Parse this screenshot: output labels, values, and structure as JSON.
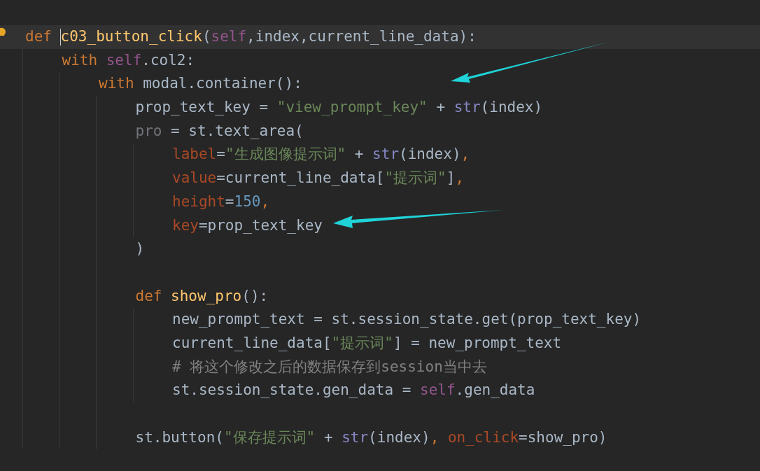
{
  "editor": {
    "lines": [
      {
        "current": true,
        "blank_line_before": false,
        "tokens": [
          {
            "kind": "keyword",
            "text": "def "
          },
          {
            "kind": "function",
            "text": "c03_button_click"
          },
          {
            "kind": "plain",
            "text": "("
          },
          {
            "kind": "self",
            "text": "self"
          },
          {
            "kind": "plain",
            "text": ",index,current_line_data):"
          }
        ],
        "children": [
          {
            "current": false,
            "blank_line_before": false,
            "tokens": [
              {
                "kind": "keyword",
                "text": "with "
              },
              {
                "kind": "self",
                "text": "self"
              },
              {
                "kind": "plain",
                "text": ".col2:"
              }
            ],
            "children": [
              {
                "current": false,
                "blank_line_before": false,
                "tokens": [
                  {
                    "kind": "keyword",
                    "text": "with "
                  },
                  {
                    "kind": "plain",
                    "text": "modal.container():"
                  }
                ],
                "children": [
                  {
                    "current": false,
                    "blank_line_before": false,
                    "tokens": [
                      {
                        "kind": "plain",
                        "text": "prop_text_key = "
                      },
                      {
                        "kind": "string",
                        "text": "\"view_prompt_key\""
                      },
                      {
                        "kind": "plain",
                        "text": " + "
                      },
                      {
                        "kind": "builtin",
                        "text": "str"
                      },
                      {
                        "kind": "plain",
                        "text": "(index)"
                      }
                    ]
                  },
                  {
                    "current": false,
                    "blank_line_before": false,
                    "tokens": [
                      {
                        "kind": "unused",
                        "text": "pro"
                      },
                      {
                        "kind": "plain",
                        "text": " = st.text_area("
                      }
                    ],
                    "children": [
                      {
                        "current": false,
                        "blank_line_before": false,
                        "tokens": [
                          {
                            "kind": "param",
                            "text": "label"
                          },
                          {
                            "kind": "plain",
                            "text": "="
                          },
                          {
                            "kind": "string",
                            "text": "\"生成图像提示词\""
                          },
                          {
                            "kind": "plain",
                            "text": " + "
                          },
                          {
                            "kind": "builtin",
                            "text": "str"
                          },
                          {
                            "kind": "plain",
                            "text": "(index)"
                          },
                          {
                            "kind": "keyword",
                            "text": ","
                          }
                        ]
                      },
                      {
                        "current": false,
                        "blank_line_before": false,
                        "tokens": [
                          {
                            "kind": "param",
                            "text": "value"
                          },
                          {
                            "kind": "plain",
                            "text": "=current_line_data["
                          },
                          {
                            "kind": "string",
                            "text": "\"提示词\""
                          },
                          {
                            "kind": "plain",
                            "text": "]"
                          },
                          {
                            "kind": "keyword",
                            "text": ","
                          }
                        ]
                      },
                      {
                        "current": false,
                        "blank_line_before": false,
                        "tokens": [
                          {
                            "kind": "param",
                            "text": "height"
                          },
                          {
                            "kind": "plain",
                            "text": "="
                          },
                          {
                            "kind": "number",
                            "text": "150"
                          },
                          {
                            "kind": "keyword",
                            "text": ","
                          }
                        ]
                      },
                      {
                        "current": false,
                        "blank_line_before": false,
                        "tokens": [
                          {
                            "kind": "param",
                            "text": "key"
                          },
                          {
                            "kind": "plain",
                            "text": "=prop_text_key"
                          }
                        ]
                      }
                    ]
                  },
                  {
                    "current": false,
                    "blank_line_before": false,
                    "tokens": [
                      {
                        "kind": "plain",
                        "text": ")"
                      }
                    ]
                  },
                  {
                    "current": false,
                    "blank_line_before": true,
                    "tokens": [
                      {
                        "kind": "keyword",
                        "text": "def "
                      },
                      {
                        "kind": "function",
                        "text": "show_pro"
                      },
                      {
                        "kind": "plain",
                        "text": "():"
                      }
                    ],
                    "children": [
                      {
                        "current": false,
                        "blank_line_before": false,
                        "tokens": [
                          {
                            "kind": "plain",
                            "text": "new_prompt_text = st.session_state.get(prop_text_key)"
                          }
                        ]
                      },
                      {
                        "current": false,
                        "blank_line_before": false,
                        "tokens": [
                          {
                            "kind": "plain",
                            "text": "current_line_data["
                          },
                          {
                            "kind": "string",
                            "text": "\"提示词\""
                          },
                          {
                            "kind": "plain",
                            "text": "] = new_prompt_text"
                          }
                        ]
                      },
                      {
                        "current": false,
                        "blank_line_before": false,
                        "tokens": [
                          {
                            "kind": "comment",
                            "text": "# 将这个修改之后的数据保存到session当中去"
                          }
                        ]
                      },
                      {
                        "current": false,
                        "blank_line_before": false,
                        "tokens": [
                          {
                            "kind": "plain",
                            "text": "st.session_state.gen_data = "
                          },
                          {
                            "kind": "self",
                            "text": "self"
                          },
                          {
                            "kind": "plain",
                            "text": ".gen_data"
                          }
                        ]
                      }
                    ]
                  },
                  {
                    "current": false,
                    "blank_line_before": true,
                    "tokens": [
                      {
                        "kind": "plain",
                        "text": "st.button("
                      },
                      {
                        "kind": "string",
                        "text": "\"保存提示词\""
                      },
                      {
                        "kind": "plain",
                        "text": " + "
                      },
                      {
                        "kind": "builtin",
                        "text": "str"
                      },
                      {
                        "kind": "plain",
                        "text": "(index)"
                      },
                      {
                        "kind": "keyword",
                        "text": ", "
                      },
                      {
                        "kind": "param",
                        "text": "on_click"
                      },
                      {
                        "kind": "plain",
                        "text": "=show_pro)"
                      }
                    ]
                  }
                ]
              }
            ]
          }
        ]
      }
    ]
  }
}
